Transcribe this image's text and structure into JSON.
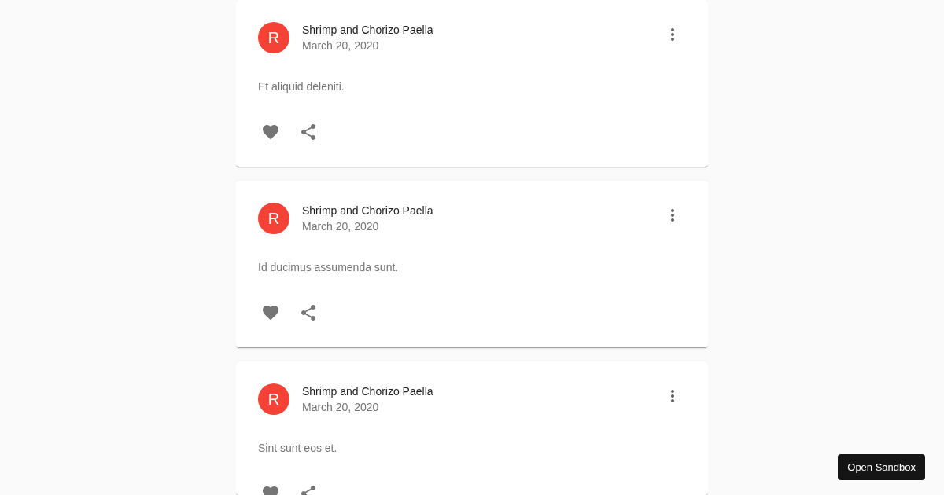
{
  "posts": [
    {
      "avatar": "R",
      "title": "Shrimp and Chorizo Paella",
      "date": "March 20, 2020",
      "text": "Et aliquid deleniti."
    },
    {
      "avatar": "R",
      "title": "Shrimp and Chorizo Paella",
      "date": "March 20, 2020",
      "text": "Id ducimus assumenda sunt."
    },
    {
      "avatar": "R",
      "title": "Shrimp and Chorizo Paella",
      "date": "March 20, 2020",
      "text": "Sint sunt eos et."
    }
  ],
  "sandbox_button": {
    "label": "Open Sandbox"
  }
}
